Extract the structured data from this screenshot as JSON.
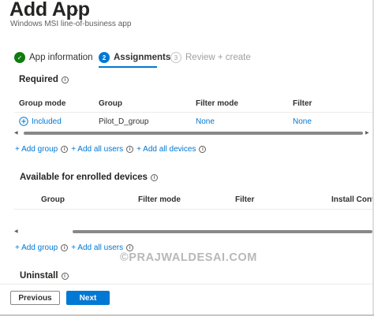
{
  "header": {
    "title": "Add App",
    "more": "···",
    "subtitle": "Windows MSI line-of-business app"
  },
  "steps": [
    {
      "number": "✓",
      "label": "App information",
      "state": "completed"
    },
    {
      "number": "2",
      "label": "Assignments",
      "state": "active"
    },
    {
      "number": "3",
      "label": "Review + create",
      "state": "upcoming"
    }
  ],
  "info_glyph": "i",
  "required": {
    "title": "Required",
    "columns": [
      "Group mode",
      "Group",
      "Filter mode",
      "Filter"
    ],
    "row": {
      "group_mode": "Included",
      "group_mode_icon": "plus-circle-icon",
      "group": "Pilot_D_group",
      "filter_mode": "None",
      "filter": "None"
    },
    "links": [
      "+ Add group",
      "+ Add all users",
      "+ Add all devices"
    ]
  },
  "available": {
    "title": "Available for enrolled devices",
    "columns": [
      "Group",
      "Filter mode",
      "Filter",
      "Install Contex"
    ],
    "links": [
      "+ Add group",
      "+ Add all users"
    ]
  },
  "uninstall": {
    "title": "Uninstall"
  },
  "watermark": "©PRAJWALDESAI.COM",
  "footer": {
    "previous": "Previous",
    "next": "Next"
  },
  "colors": {
    "accent": "#0078d4",
    "success": "#107c10"
  }
}
